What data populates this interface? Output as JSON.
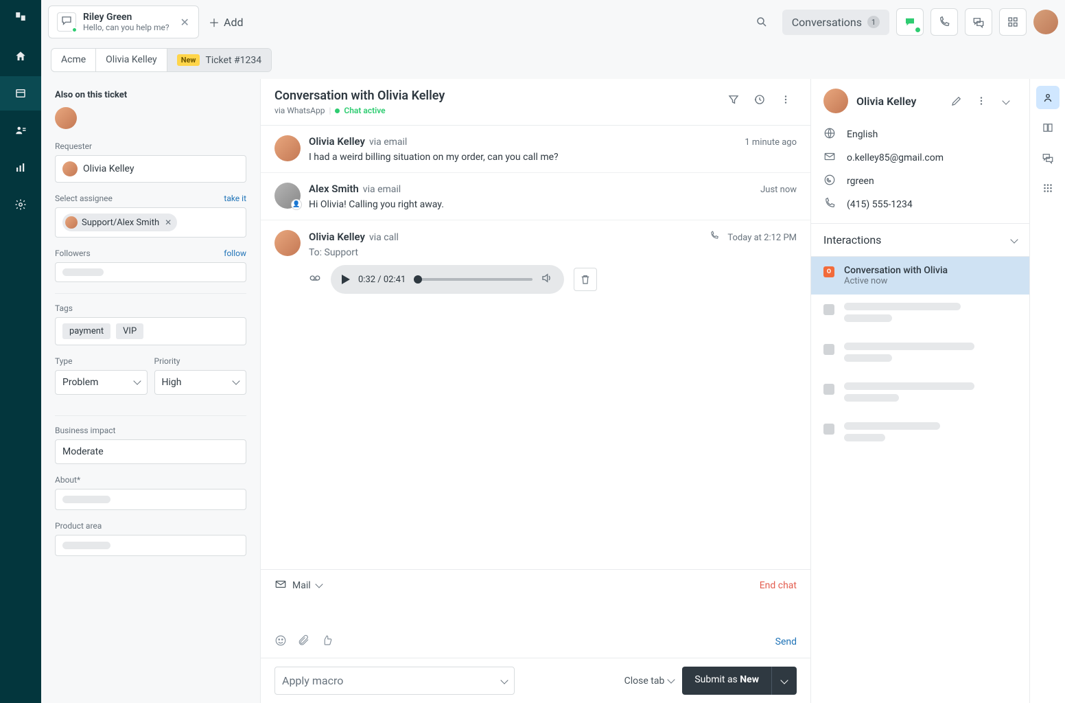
{
  "tab": {
    "title": "Riley Green",
    "subtitle": "Hello, can you help me?",
    "add_label": "Add"
  },
  "topbar": {
    "conversations_label": "Conversations",
    "conversations_count": "1"
  },
  "breadcrumb": {
    "org": "Acme",
    "user": "Olivia Kelley",
    "ticket_badge": "New",
    "ticket": "Ticket #1234"
  },
  "left": {
    "also_heading": "Also on this ticket",
    "requester_label": "Requester",
    "requester": "Olivia Kelley",
    "assignee_label": "Select assignee",
    "take_it": "take it",
    "assignee": "Support/Alex Smith",
    "followers_label": "Followers",
    "follow": "follow",
    "tags_label": "Tags",
    "tags": [
      "payment",
      "VIP"
    ],
    "type_label": "Type",
    "type": "Problem",
    "priority_label": "Priority",
    "priority": "High",
    "impact_label": "Business impact",
    "impact": "Moderate",
    "about_label": "About*",
    "product_label": "Product area"
  },
  "conv": {
    "title": "Conversation with Olivia Kelley",
    "via": "via WhatsApp",
    "status": "Chat active",
    "messages": [
      {
        "name": "Olivia Kelley",
        "via": "via email",
        "time": "1 minute ago",
        "body": "I had a weird billing situation on my order, can you call me?"
      },
      {
        "name": "Alex Smith",
        "via": "via email",
        "time": "Just now",
        "body": "Hi Olivia! Calling you right away."
      },
      {
        "name": "Olivia Kelley",
        "via": "via call",
        "time": "Today at 2:12 PM",
        "body": "To: Support"
      }
    ],
    "audio_time": "0:32 / 02:41"
  },
  "compose": {
    "channel": "Mail",
    "end": "End chat",
    "send": "Send"
  },
  "bottom": {
    "macro": "Apply macro",
    "close_tab": "Close tab",
    "submit_prefix": "Submit as ",
    "submit_status": "New"
  },
  "context": {
    "name": "Olivia Kelley",
    "language": "English",
    "email": "o.kelley85@gmail.com",
    "handle": "rgreen",
    "phone": "(415) 555-1234",
    "interactions_heading": "Interactions",
    "active_title": "Conversation with Olivia",
    "active_sub": "Active now"
  }
}
